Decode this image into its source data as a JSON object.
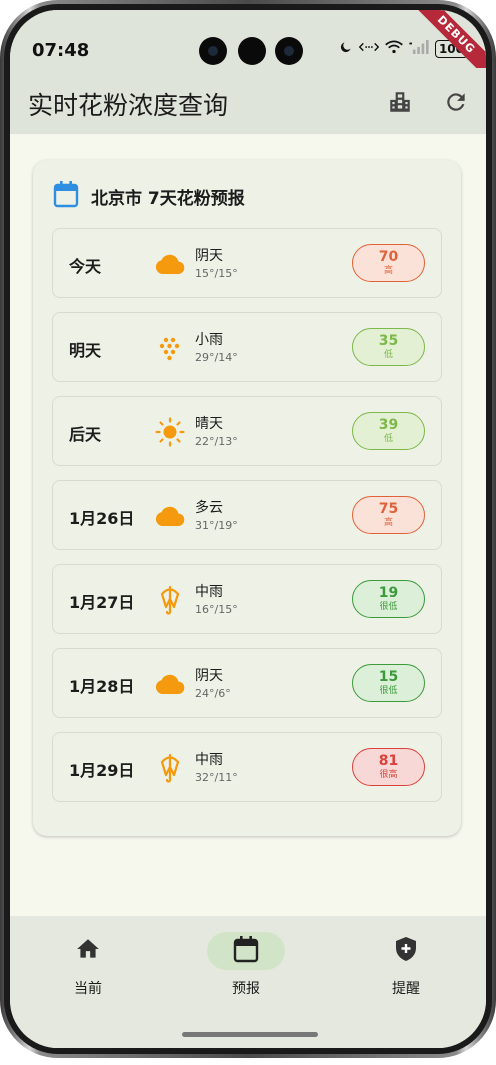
{
  "status_bar": {
    "time": "07:48",
    "battery": "100"
  },
  "debug_banner": "DEBUG",
  "app_bar": {
    "title": "实时花粉浓度查询"
  },
  "card": {
    "title": "北京市 7天花粉预报"
  },
  "forecast": [
    {
      "day": "今天",
      "icon": "cloud-icon",
      "condition": "阴天",
      "temp": "15°/15°",
      "value": "70",
      "level": "高",
      "color": "#e0623a",
      "bg": "#fbe2d8"
    },
    {
      "day": "明天",
      "icon": "rain-dots-icon",
      "condition": "小雨",
      "temp": "29°/14°",
      "value": "35",
      "level": "低",
      "color": "#7cb84a",
      "bg": "#e4f0d4"
    },
    {
      "day": "后天",
      "icon": "sun-icon",
      "condition": "晴天",
      "temp": "22°/13°",
      "value": "39",
      "level": "低",
      "color": "#7cb84a",
      "bg": "#e4f0d4"
    },
    {
      "day": "1月26日",
      "icon": "cloud-icon",
      "condition": "多云",
      "temp": "31°/19°",
      "value": "75",
      "level": "高",
      "color": "#e0623a",
      "bg": "#fbe2d8"
    },
    {
      "day": "1月27日",
      "icon": "umbrella-icon",
      "condition": "中雨",
      "temp": "16°/15°",
      "value": "19",
      "level": "很低",
      "color": "#3c9a3c",
      "bg": "#dcefd8"
    },
    {
      "day": "1月28日",
      "icon": "cloud-icon",
      "condition": "阴天",
      "temp": "24°/6°",
      "value": "15",
      "level": "很低",
      "color": "#3c9a3c",
      "bg": "#dcefd8"
    },
    {
      "day": "1月29日",
      "icon": "umbrella-icon",
      "condition": "中雨",
      "temp": "32°/11°",
      "value": "81",
      "level": "很高",
      "color": "#d9413a",
      "bg": "#f8d8d6"
    }
  ],
  "bottom_nav": [
    {
      "label": "当前",
      "icon": "home-icon",
      "active": false
    },
    {
      "label": "预报",
      "icon": "calendar-icon",
      "active": true
    },
    {
      "label": "提醒",
      "icon": "shield-plus-icon",
      "active": false
    }
  ],
  "colors": {
    "weather_icon": "#f59a0e",
    "accent_blue": "#2f8ee0"
  }
}
